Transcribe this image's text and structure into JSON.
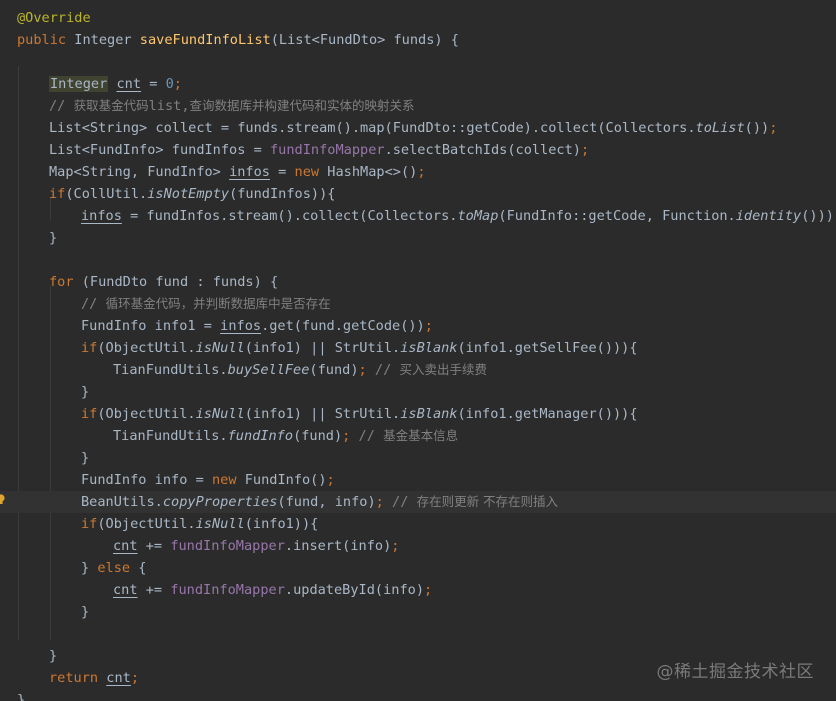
{
  "editor": {
    "lines": [
      {
        "indent": 0,
        "current": false,
        "tokens": [
          {
            "t": "@Override",
            "c": "ann"
          }
        ]
      },
      {
        "indent": 0,
        "current": false,
        "tokens": [
          {
            "t": "public ",
            "c": "kw"
          },
          {
            "t": "Integer ",
            "c": ""
          },
          {
            "t": "saveFundInfoList",
            "c": "fn"
          },
          {
            "t": "(List<FundDto> funds) {",
            "c": ""
          }
        ]
      },
      {
        "indent": 0,
        "current": false,
        "tokens": []
      },
      {
        "indent": 1,
        "current": false,
        "tokens": [
          {
            "t": "Integer",
            "c": "hl"
          },
          {
            "t": " ",
            "c": ""
          },
          {
            "t": "cnt",
            "c": "ul"
          },
          {
            "t": " = ",
            "c": ""
          },
          {
            "t": "0",
            "c": "num"
          },
          {
            "t": ";",
            "c": "kw"
          }
        ]
      },
      {
        "indent": 1,
        "current": false,
        "tokens": [
          {
            "t": "// ",
            "c": "cm"
          },
          {
            "t": "获取基金代码",
            "c": "cm cjk"
          },
          {
            "t": "list,",
            "c": "cm"
          },
          {
            "t": "查询数据库并构建代码和实体的映射关系",
            "c": "cm cjk"
          }
        ]
      },
      {
        "indent": 1,
        "current": false,
        "tokens": [
          {
            "t": "List<String> collect = funds.stream().map(FundDto::getCode).collect(Collectors.",
            "c": ""
          },
          {
            "t": "toList",
            "c": "it"
          },
          {
            "t": "())",
            "c": ""
          },
          {
            "t": ";",
            "c": "kw"
          }
        ]
      },
      {
        "indent": 1,
        "current": false,
        "tokens": [
          {
            "t": "List<FundInfo> fundInfos = ",
            "c": ""
          },
          {
            "t": "fundInfoMapper",
            "c": "field"
          },
          {
            "t": ".selectBatchIds(collect)",
            "c": ""
          },
          {
            "t": ";",
            "c": "kw"
          }
        ]
      },
      {
        "indent": 1,
        "current": false,
        "tokens": [
          {
            "t": "Map<String, FundInfo> ",
            "c": ""
          },
          {
            "t": "infos",
            "c": "ul"
          },
          {
            "t": " = ",
            "c": ""
          },
          {
            "t": "new ",
            "c": "kw"
          },
          {
            "t": "HashMap<>()",
            "c": ""
          },
          {
            "t": ";",
            "c": "kw"
          }
        ]
      },
      {
        "indent": 1,
        "current": false,
        "tokens": [
          {
            "t": "if",
            "c": "kw"
          },
          {
            "t": "(CollUtil.",
            "c": ""
          },
          {
            "t": "isNotEmpty",
            "c": "it"
          },
          {
            "t": "(fundInfos)){",
            "c": ""
          }
        ]
      },
      {
        "indent": 2,
        "current": false,
        "tokens": [
          {
            "t": "infos",
            "c": "ul"
          },
          {
            "t": " = fundInfos.stream().collect(Collectors.",
            "c": ""
          },
          {
            "t": "toMap",
            "c": "it"
          },
          {
            "t": "(FundInfo::getCode, Function.",
            "c": ""
          },
          {
            "t": "identity",
            "c": "it"
          },
          {
            "t": "()))",
            "c": ""
          },
          {
            "t": ";",
            "c": "kw"
          }
        ]
      },
      {
        "indent": 1,
        "current": false,
        "tokens": [
          {
            "t": "}",
            "c": ""
          }
        ]
      },
      {
        "indent": 0,
        "current": false,
        "tokens": []
      },
      {
        "indent": 1,
        "current": false,
        "tokens": [
          {
            "t": "for ",
            "c": "kw"
          },
          {
            "t": "(FundDto fund : funds) {",
            "c": ""
          }
        ]
      },
      {
        "indent": 2,
        "current": false,
        "tokens": [
          {
            "t": "// ",
            "c": "cm"
          },
          {
            "t": "循环基金代码，并判断数据库中是否存在",
            "c": "cm cjk"
          }
        ]
      },
      {
        "indent": 2,
        "current": false,
        "tokens": [
          {
            "t": "FundInfo info1 = ",
            "c": ""
          },
          {
            "t": "infos",
            "c": "ul"
          },
          {
            "t": ".get(fund.getCode())",
            "c": ""
          },
          {
            "t": ";",
            "c": "kw"
          }
        ]
      },
      {
        "indent": 2,
        "current": false,
        "tokens": [
          {
            "t": "if",
            "c": "kw"
          },
          {
            "t": "(ObjectUtil.",
            "c": ""
          },
          {
            "t": "isNull",
            "c": "it"
          },
          {
            "t": "(info1) || StrUtil.",
            "c": ""
          },
          {
            "t": "isBlank",
            "c": "it"
          },
          {
            "t": "(info1.getSellFee())){",
            "c": ""
          }
        ]
      },
      {
        "indent": 3,
        "current": false,
        "tokens": [
          {
            "t": "TianFundUtils.",
            "c": ""
          },
          {
            "t": "buySellFee",
            "c": "it"
          },
          {
            "t": "(fund)",
            "c": ""
          },
          {
            "t": ";",
            "c": "kw"
          },
          {
            "t": " // ",
            "c": "cm"
          },
          {
            "t": "买入卖出手续费",
            "c": "cm cjk"
          }
        ]
      },
      {
        "indent": 2,
        "current": false,
        "tokens": [
          {
            "t": "}",
            "c": ""
          }
        ]
      },
      {
        "indent": 2,
        "current": false,
        "tokens": [
          {
            "t": "if",
            "c": "kw"
          },
          {
            "t": "(ObjectUtil.",
            "c": ""
          },
          {
            "t": "isNull",
            "c": "it"
          },
          {
            "t": "(info1) || StrUtil.",
            "c": ""
          },
          {
            "t": "isBlank",
            "c": "it"
          },
          {
            "t": "(info1.getManager())){",
            "c": ""
          }
        ]
      },
      {
        "indent": 3,
        "current": false,
        "tokens": [
          {
            "t": "TianFundUtils.",
            "c": ""
          },
          {
            "t": "fundInfo",
            "c": "it"
          },
          {
            "t": "(fund)",
            "c": ""
          },
          {
            "t": ";",
            "c": "kw"
          },
          {
            "t": " // ",
            "c": "cm"
          },
          {
            "t": "基金基本信息",
            "c": "cm cjk"
          }
        ]
      },
      {
        "indent": 2,
        "current": false,
        "tokens": [
          {
            "t": "}",
            "c": ""
          }
        ]
      },
      {
        "indent": 2,
        "current": false,
        "tokens": [
          {
            "t": "FundInfo info = ",
            "c": ""
          },
          {
            "t": "new ",
            "c": "kw"
          },
          {
            "t": "FundInfo()",
            "c": ""
          },
          {
            "t": ";",
            "c": "kw"
          }
        ]
      },
      {
        "indent": 2,
        "current": true,
        "tokens": [
          {
            "t": "BeanUtils.",
            "c": ""
          },
          {
            "t": "copyProperties",
            "c": "it"
          },
          {
            "t": "(fund, info)",
            "c": ""
          },
          {
            "t": ";",
            "c": "kw"
          },
          {
            "t": " // ",
            "c": "cm"
          },
          {
            "t": "存在则更新 不存在则插入",
            "c": "cm cjk"
          }
        ]
      },
      {
        "indent": 2,
        "current": false,
        "tokens": [
          {
            "t": "if",
            "c": "kw"
          },
          {
            "t": "(ObjectUtil.",
            "c": ""
          },
          {
            "t": "isNull",
            "c": "it"
          },
          {
            "t": "(info1)){",
            "c": ""
          }
        ]
      },
      {
        "indent": 3,
        "current": false,
        "tokens": [
          {
            "t": "cnt",
            "c": "ul"
          },
          {
            "t": " += ",
            "c": ""
          },
          {
            "t": "fundInfoMapper",
            "c": "field"
          },
          {
            "t": ".insert(info)",
            "c": ""
          },
          {
            "t": ";",
            "c": "kw"
          }
        ]
      },
      {
        "indent": 2,
        "current": false,
        "tokens": [
          {
            "t": "} ",
            "c": ""
          },
          {
            "t": "else ",
            "c": "kw"
          },
          {
            "t": "{",
            "c": ""
          }
        ]
      },
      {
        "indent": 3,
        "current": false,
        "tokens": [
          {
            "t": "cnt",
            "c": "ul"
          },
          {
            "t": " += ",
            "c": ""
          },
          {
            "t": "fundInfoMapper",
            "c": "field"
          },
          {
            "t": ".updateById(info)",
            "c": ""
          },
          {
            "t": ";",
            "c": "kw"
          }
        ]
      },
      {
        "indent": 2,
        "current": false,
        "tokens": [
          {
            "t": "}",
            "c": ""
          }
        ]
      },
      {
        "indent": 0,
        "current": false,
        "tokens": []
      },
      {
        "indent": 1,
        "current": false,
        "tokens": [
          {
            "t": "}",
            "c": ""
          }
        ]
      },
      {
        "indent": 1,
        "current": false,
        "tokens": [
          {
            "t": "return ",
            "c": "kw"
          },
          {
            "t": "cnt",
            "c": "ul"
          },
          {
            "t": ";",
            "c": "kw"
          }
        ]
      },
      {
        "indent": 0,
        "current": false,
        "tokens": [
          {
            "t": "}",
            "c": ""
          }
        ]
      }
    ]
  },
  "gutter": {
    "icon": "lightbulb-icon",
    "color": "#e0a431"
  },
  "watermark": {
    "text": "@稀土掘金技术社区"
  },
  "colors": {
    "background": "#2b2b2b",
    "default_text": "#a9b7c6",
    "keyword": "#cc7832",
    "method_declaration": "#ffc66d",
    "number": "#6897bb",
    "comment": "#808080",
    "field": "#9876aa",
    "annotation": "#bbb529"
  }
}
